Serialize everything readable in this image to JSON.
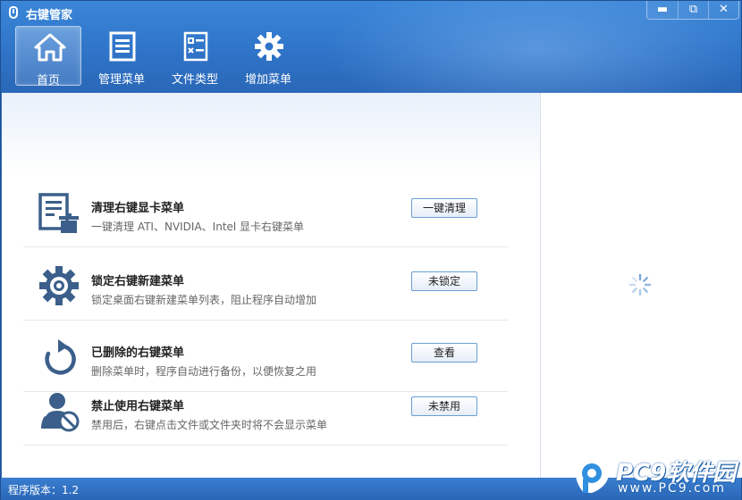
{
  "window": {
    "title": "右键管家",
    "controls": {
      "minimize": "▬",
      "restore": "⧉",
      "close": "✕"
    }
  },
  "nav": {
    "items": [
      {
        "label": "首页",
        "icon": "home-icon",
        "active": true
      },
      {
        "label": "管理菜单",
        "icon": "menu-list-icon",
        "active": false
      },
      {
        "label": "文件类型",
        "icon": "file-type-icon",
        "active": false
      },
      {
        "label": "增加菜单",
        "icon": "gear-icon",
        "active": false
      }
    ]
  },
  "features": [
    {
      "title": "清理右键显卡菜单",
      "desc": "一键清理 ATI、NVIDIA、Intel 显卡右键菜单",
      "button": "一键清理",
      "icon": "clean-document-icon"
    },
    {
      "title": "锁定右键新建菜单",
      "desc": "锁定桌面右键新建菜单列表，阻止程序自动增加",
      "button": "未锁定",
      "icon": "gear-icon"
    },
    {
      "title": "已删除的右键菜单",
      "desc": "删除菜单时，程序自动进行备份，以便恢复之用",
      "button": "查看",
      "icon": "restore-arrow-icon"
    },
    {
      "title": "禁止使用右键菜单",
      "desc": "禁用后，右键点击文件或文件夹时将不会显示菜单",
      "button": "未禁用",
      "icon": "user-block-icon"
    }
  ],
  "status": {
    "version_text": "程序版本：1.2"
  },
  "watermark": {
    "brand": "PC9软件园",
    "url": "www.PC9.com"
  },
  "colors": {
    "header": "#2f74c8",
    "accent_icon": "#3b5f8a",
    "button_border": "#6a9fd3"
  }
}
